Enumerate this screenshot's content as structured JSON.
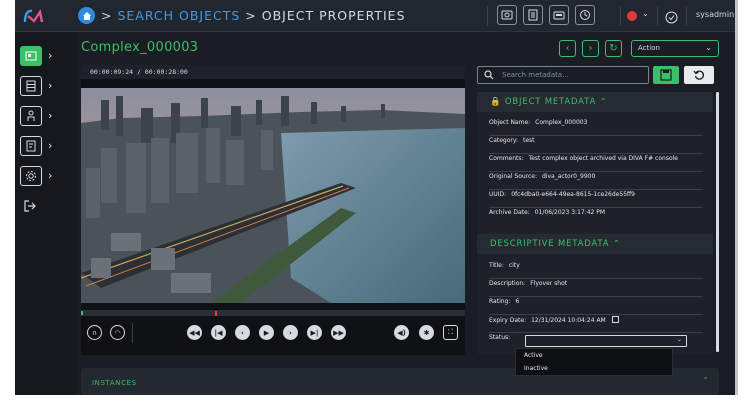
{
  "header": {
    "crumb_link": "SEARCH OBJECTS",
    "crumb_sep1": " > ",
    "crumb_sep2": " > ",
    "crumb_current": "OBJECT PROPERTIES",
    "user": "sysadmin",
    "icons": [
      "vault-icon",
      "document-icon",
      "tape-icon",
      "history-icon",
      "record-status-icon",
      "chevron-down-icon",
      "check-circle-icon"
    ]
  },
  "object": {
    "name": "Complex_000003"
  },
  "action": {
    "label": "Action"
  },
  "player": {
    "current_time": "00:00:09:24",
    "separator": " / ",
    "duration": "00:00:28:00",
    "playback_progress": 0.35
  },
  "search": {
    "placeholder": "Search metadata..."
  },
  "object_metadata": {
    "title": "OBJECT METADATA",
    "fields": [
      {
        "label": "Object Name:",
        "value": "Complex_000003"
      },
      {
        "label": "Category:",
        "value": "test"
      },
      {
        "label": "Comments:",
        "value": "Test complex object archived via DIVA F# console"
      },
      {
        "label": "Original Source:",
        "value": "diva_actor0_9900"
      },
      {
        "label": "UUID:",
        "value": "0fc4dba0-e664-49ea-8615-1ce26de55ff9"
      },
      {
        "label": "Archive Date:",
        "value": "01/06/2023 3:17:42 PM"
      }
    ]
  },
  "descriptive_metadata": {
    "title": "DESCRIPTIVE METADATA",
    "fields": [
      {
        "label": "Title:",
        "value": "city"
      },
      {
        "label": "Description:",
        "value": "Flyover shot"
      },
      {
        "label": "Rating:",
        "value": "6"
      },
      {
        "label": "Expiry Date:",
        "value": "12/31/2024 10:04:24 AM"
      },
      {
        "label": "Status:",
        "value": ""
      }
    ],
    "status_options": [
      "Active",
      "Inactive"
    ]
  },
  "instances": {
    "title": "INSTANCES"
  },
  "colors": {
    "accent": "#3bbf6a",
    "link": "#3d9be9",
    "background": "#1a1d23",
    "record": "#e33b3b"
  }
}
